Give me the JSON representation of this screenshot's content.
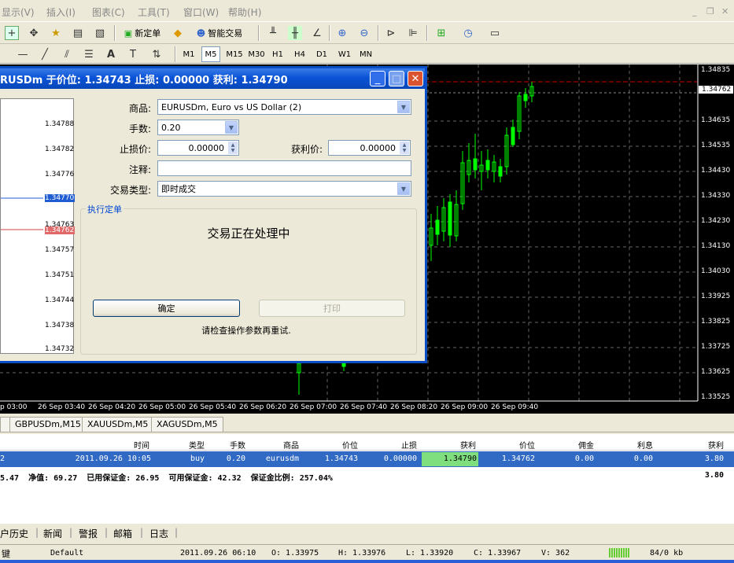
{
  "menu": [
    "显示(V)",
    "插入(I)",
    "图表(C)",
    "工具(T)",
    "窗口(W)",
    "帮助(H)"
  ],
  "toolbar": {
    "new_order": "新定单",
    "expert": "智能交易"
  },
  "timeframes": [
    "M1",
    "M5",
    "M15",
    "M30",
    "H1",
    "H4",
    "D1",
    "W1",
    "MN"
  ],
  "timeframe_selected": "M5",
  "chart": {
    "price_labels": [
      "1.34835",
      "1.34762",
      "1.34635",
      "1.34535",
      "1.34430",
      "1.34330",
      "1.34230",
      "1.34130",
      "1.34030",
      "1.33925",
      "1.33825",
      "1.33725",
      "1.33625",
      "1.33525"
    ],
    "current_price": "1.34762",
    "time_labels": [
      "p 03:00",
      "26 Sep 03:40",
      "26 Sep 04:20",
      "26 Sep 05:00",
      "26 Sep 05:40",
      "26 Sep 06:20",
      "26 Sep 07:00",
      "26 Sep 07:40",
      "26 Sep 08:20",
      "26 Sep 09:00",
      "26 Sep 09:40"
    ]
  },
  "dialog": {
    "title": "RUSDm 于价位: 1.34743 止损: 0.00000 获利: 1.34790",
    "symbol_label": "商品:",
    "symbol_value": "EURUSDm, Euro vs US Dollar (2)",
    "volume_label": "手数:",
    "volume_value": "0.20",
    "sl_label": "止损价:",
    "sl_value": "0.00000",
    "tp_label": "获利价:",
    "tp_value": "0.00000",
    "comment_label": "注释:",
    "comment_value": "",
    "type_label": "交易类型:",
    "type_value": "即时成交",
    "group_title": "执行定单",
    "processing": "交易正在处理中",
    "ok_button": "确定",
    "print_button": "打印",
    "message": "请检查操作参数再重试.",
    "mini_prices": [
      "1.34788",
      "1.34782",
      "1.34776",
      "1.34770",
      "1.34763",
      "1.34762",
      "1.34757",
      "1.34751",
      "1.34744",
      "1.34738",
      "1.34732"
    ]
  },
  "chart_tabs": [
    "GBPUSDm,M15",
    "XAUUSDm,M5",
    "XAGUSDm,M5"
  ],
  "terminal": {
    "headers": [
      "时间",
      "类型",
      "手数",
      "商品",
      "价位",
      "止损",
      "获利",
      "价位",
      "佣金",
      "利息",
      "获利"
    ],
    "row": [
      "2",
      "2011.09.26 10:05",
      "buy",
      "0.20",
      "eurusdm",
      "1.34743",
      "0.00000",
      "1.34790",
      "1.34762",
      "0.00",
      "0.00",
      "3.80"
    ],
    "summary": "5.47  净值: 69.27  已用保证金: 26.95  可用保证金: 42.32  保证金比例: 257.04%",
    "summary_profit": "3.80"
  },
  "bottom_tabs": [
    "户历史",
    "新闻",
    "警报",
    "邮箱",
    "日志"
  ],
  "status": {
    "first": "键",
    "profile": "Default",
    "datetime": "2011.09.26 06:10",
    "open": "O: 1.33975",
    "high": "H: 1.33976",
    "low": "L: 1.33920",
    "close": "C: 1.33967",
    "volume": "V: 362",
    "traffic": "84/0 kb"
  }
}
